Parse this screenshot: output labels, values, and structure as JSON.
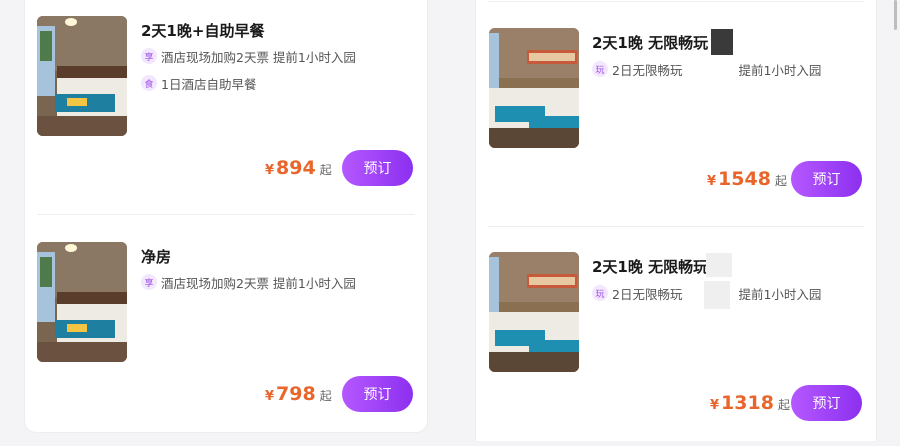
{
  "left": [
    {
      "title": "2天1晚+自助早餐",
      "features": [
        {
          "tag": "享",
          "text": "酒店现场加购2天票 提前1小时入园"
        },
        {
          "tag": "食",
          "text": "1日酒店自助早餐"
        }
      ],
      "price": "894",
      "currency": "¥",
      "suffix": "起",
      "button": "预订"
    },
    {
      "title": "净房",
      "features": [
        {
          "tag": "享",
          "text": "酒店现场加购2天票 提前1小时入园"
        }
      ],
      "price": "798",
      "currency": "¥",
      "suffix": "起",
      "button": "预订"
    }
  ],
  "right": [
    {
      "title": "2天1晚 无限畅玩",
      "feature_tag": "玩",
      "feature_text_a": "2日无限畅玩",
      "feature_text_b": "提前1小时入园",
      "price": "1548",
      "currency": "¥",
      "suffix": "起",
      "button": "预订"
    },
    {
      "title": "2天1晚 无限畅玩",
      "feature_tag": "玩",
      "feature_text_a": "2日无限畅玩",
      "feature_text_b": "提前1小时入园",
      "price": "1318",
      "currency": "¥",
      "suffix": "起",
      "button": "预订"
    }
  ],
  "colors": {
    "accent_price": "#e8662c",
    "button_start": "#b558ff",
    "button_end": "#8c30f0",
    "tag_bg": "#f3e6ff",
    "tag_fg": "#9b52e6"
  },
  "icons": [
    "hotel-room-photo"
  ]
}
